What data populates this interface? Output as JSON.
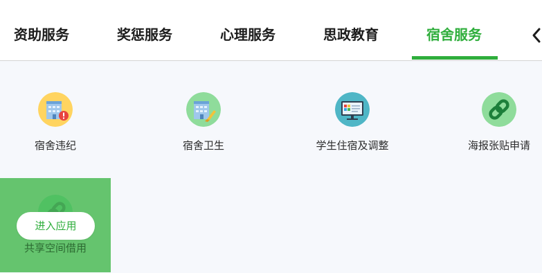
{
  "tabs": [
    {
      "label": "资助服务",
      "active": false
    },
    {
      "label": "奖惩服务",
      "active": false
    },
    {
      "label": "心理服务",
      "active": false
    },
    {
      "label": "思政教育",
      "active": false
    },
    {
      "label": "宿舍服务",
      "active": true
    }
  ],
  "accent_color": "#2fae3c",
  "apps": [
    {
      "label": "宿舍违纪",
      "icon": "dorm-violation-icon"
    },
    {
      "label": "宿舍卫生",
      "icon": "dorm-hygiene-icon"
    },
    {
      "label": "学生住宿及调整",
      "icon": "accommodation-monitor-icon"
    },
    {
      "label": "海报张贴申请",
      "icon": "link-icon"
    },
    {
      "label": "共享空间借用",
      "icon": "link-icon"
    }
  ],
  "enter_button": "进入应用"
}
